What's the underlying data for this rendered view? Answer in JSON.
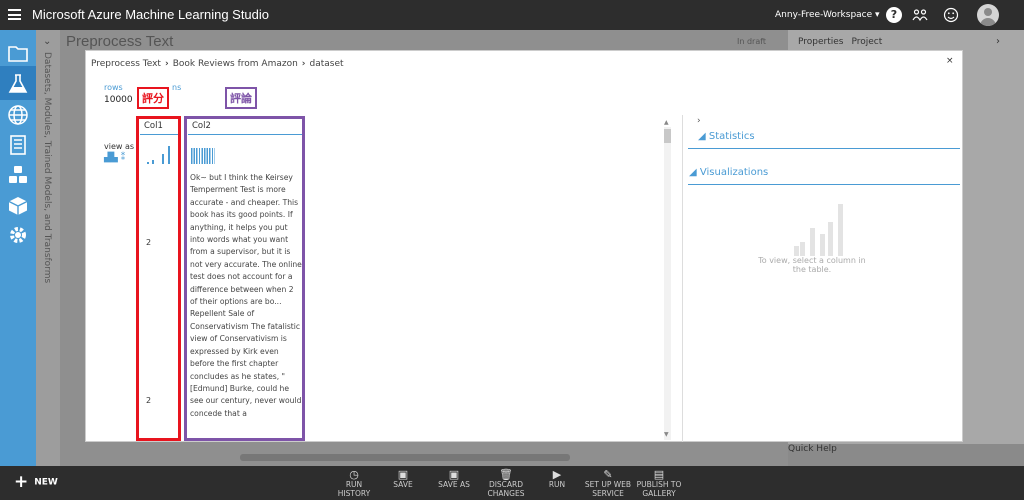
{
  "app": {
    "title": "Microsoft Azure Machine Learning Studio",
    "workspace": "Anny-Free-Workspace ▾"
  },
  "left_nav": {
    "strip_text": "Datasets, Modules, Trained Models, and Transforms",
    "items": [
      "projects-icon",
      "experiments-icon",
      "web-services-icon",
      "notebooks-icon",
      "datasets-icon",
      "trained-models-icon",
      "settings-icon"
    ]
  },
  "background": {
    "title": "Preprocess Text",
    "status": "In draft",
    "tabs": [
      "Properties",
      "Project"
    ],
    "quick_help": "Quick Help"
  },
  "modal": {
    "breadcrumb": [
      "Preprocess Text",
      "Book Reviews from Amazon",
      "dataset"
    ],
    "close": "×",
    "rows_label": "rows",
    "rows_value": "10000",
    "columns_label": "ns",
    "view_as": "view as",
    "columns": [
      {
        "header": "Col1",
        "cells": [
          "2",
          "2"
        ]
      },
      {
        "header": "Col2",
        "text": "Ok~ but I think the Keirsey Temperment Test is more accurate - and cheaper. This book has its good points. If anything, it helps you put into words what you want from a supervisor, but it is not very accurate. The online test does not account for a difference between when 2 of their options are bo... Repellent Sale of Conservativism The fatalistic view of Conservativism is expressed by Kirk even before the first chapter concludes as he states, \" [Edmund] Burke, could he see our century, never would concede that a"
      }
    ],
    "statistics": "Statistics",
    "visualizations": "Visualizations",
    "hint": "To view, select a column in the table."
  },
  "annotations": {
    "col1": "評分",
    "col2": "評論"
  },
  "bottom_bar": {
    "new": "NEW",
    "buttons": [
      {
        "label": "RUN\nHISTORY",
        "icon": "clock-icon"
      },
      {
        "label": "SAVE",
        "icon": "save-icon"
      },
      {
        "label": "SAVE AS",
        "icon": "save-as-icon"
      },
      {
        "label": "DISCARD\nCHANGES",
        "icon": "trash-icon"
      },
      {
        "label": "RUN",
        "icon": "play-icon"
      },
      {
        "label": "SET UP WEB\nSERVICE",
        "icon": "wrench-icon"
      },
      {
        "label": "PUBLISH TO\nGALLERY",
        "icon": "gallery-icon"
      }
    ]
  },
  "colors": {
    "accent": "#4a9bd4",
    "topbar": "#2d2d2d",
    "annotation_red": "#e8141e",
    "annotation_purple": "#7e54a8"
  }
}
